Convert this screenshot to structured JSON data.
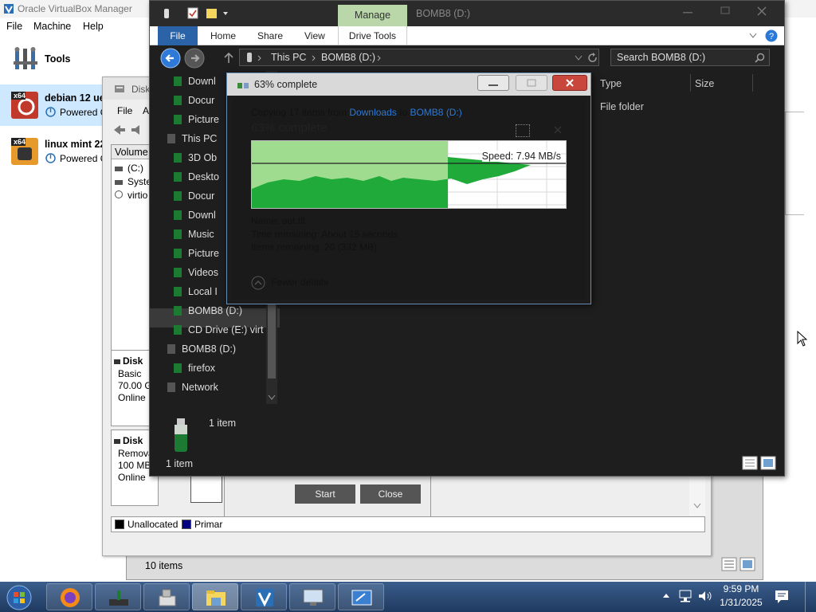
{
  "vbox": {
    "title": "Oracle VirtualBox Manager",
    "menu": [
      "File",
      "Machine",
      "Help"
    ],
    "tools_label": "Tools",
    "vms": [
      {
        "name": "debian 12 ue",
        "arch": "x64",
        "state": "Powered O"
      },
      {
        "name": "linux mint 22",
        "arch": "x64",
        "state": "Powered O"
      }
    ]
  },
  "disk_window": {
    "title": "Disk",
    "menu": [
      "File",
      "A"
    ],
    "column_header": "Volume",
    "volumes": [
      "(C:)",
      "Syster",
      "virtio"
    ],
    "disks": [
      {
        "label": "Disk",
        "type": "Basic",
        "size": "70.00 G",
        "status": "Online"
      },
      {
        "label": "Disk",
        "type": "Remova",
        "size": "100 MB",
        "status": "Online"
      }
    ],
    "legend": [
      {
        "label": "Unallocated",
        "color": "#000000"
      },
      {
        "label": "Primar",
        "color": "#000080"
      }
    ],
    "start_label": "Start",
    "close_label": "Close",
    "status_items": "10 items"
  },
  "explorer": {
    "ribbon_context": "Manage",
    "window_title": "BOMB8 (D:)",
    "tabs": [
      "File",
      "Home",
      "Share",
      "View",
      "Drive Tools"
    ],
    "breadcrumb": [
      "This PC",
      "BOMB8 (D:)"
    ],
    "search_placeholder": "Search BOMB8 (D:)",
    "nav": [
      {
        "label": "Downl",
        "indent": 1
      },
      {
        "label": "Docur",
        "indent": 1
      },
      {
        "label": "Picture",
        "indent": 1
      },
      {
        "label": "This PC",
        "indent": 0
      },
      {
        "label": "3D Ob",
        "indent": 1
      },
      {
        "label": "Deskto",
        "indent": 1
      },
      {
        "label": "Docur",
        "indent": 1
      },
      {
        "label": "Downl",
        "indent": 1
      },
      {
        "label": "Music",
        "indent": 1
      },
      {
        "label": "Picture",
        "indent": 1
      },
      {
        "label": "Videos",
        "indent": 1
      },
      {
        "label": "Local I",
        "indent": 1
      },
      {
        "label": "BOMB8 (D:)",
        "indent": 1
      },
      {
        "label": "CD Drive (E:) virt",
        "indent": 1
      },
      {
        "label": "BOMB8 (D:)",
        "indent": 0
      },
      {
        "label": "firefox",
        "indent": 1
      },
      {
        "label": "Network",
        "indent": 0
      }
    ],
    "columns": [
      "Type",
      "Size"
    ],
    "row_type": "File folder",
    "details_count": "1 item",
    "status": "1 item"
  },
  "copy_dialog": {
    "title": "63% complete",
    "copying_prefix": "Copying 17 items from",
    "source": "Downloads",
    "to_word": "to",
    "destination": "BOMB8 (D:)",
    "heading": "63% complete",
    "speed": "Speed: 7.94 MB/s",
    "progress": 0.63,
    "name_line": "Name: out.tfl",
    "time_line": "Time remaining: About 15 seconds",
    "items_line": "Items remaining: 20 (332 MB)",
    "fewer_details": "Fewer details"
  },
  "taskbar": {
    "time": "9:59 PM",
    "date": "1/31/2025"
  }
}
